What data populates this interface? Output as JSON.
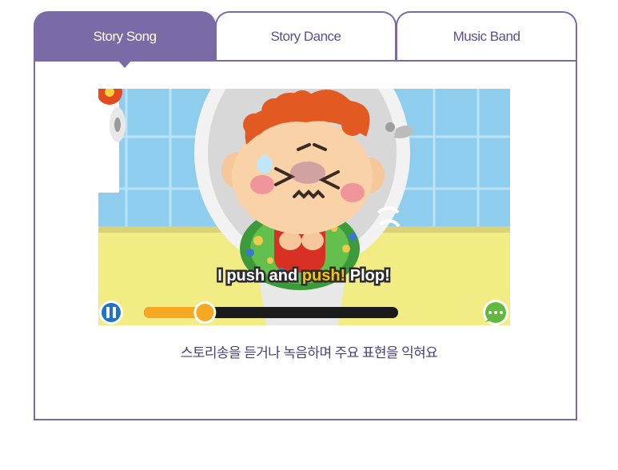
{
  "tabs": [
    {
      "label": "Story Song",
      "active": true
    },
    {
      "label": "Story Dance",
      "active": false
    },
    {
      "label": "Music Band",
      "active": false
    }
  ],
  "video": {
    "subtitle_part1": "I push and ",
    "subtitle_highlight": "push!",
    "subtitle_part2": " Plop!",
    "progress": 0.24,
    "state": "playing",
    "play_icon": "pause-icon",
    "chat_icon": "chat-bubble-icon"
  },
  "caption": "스토리송을 듣거나 녹음하며 주요 표현을 익혀요",
  "colors": {
    "accent": "#7a6aa6",
    "progress": "#f7a823",
    "highlight": "#f5c400"
  }
}
